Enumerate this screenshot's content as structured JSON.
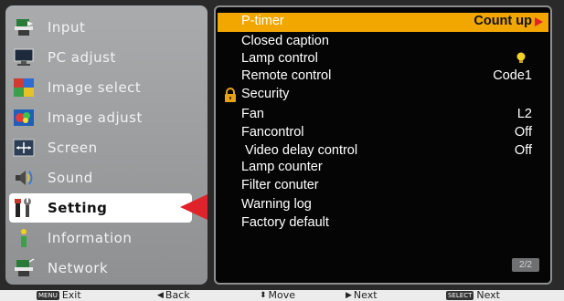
{
  "left_menu": {
    "items": [
      {
        "label": "Input",
        "icon": "input-icon"
      },
      {
        "label": "PC adjust",
        "icon": "pc-adjust-icon"
      },
      {
        "label": "Image select",
        "icon": "image-select-icon"
      },
      {
        "label": "Image adjust",
        "icon": "image-adjust-icon"
      },
      {
        "label": "Screen",
        "icon": "screen-icon"
      },
      {
        "label": "Sound",
        "icon": "sound-icon"
      },
      {
        "label": "Setting",
        "icon": "setting-icon"
      },
      {
        "label": "Information",
        "icon": "information-icon"
      },
      {
        "label": "Network",
        "icon": "network-icon"
      }
    ],
    "active_index": 6
  },
  "settings": {
    "rows": [
      {
        "name": "P-timer",
        "value": "Count up"
      },
      {
        "name": "Closed caption",
        "value": ""
      },
      {
        "name": "Lamp control",
        "value": ""
      },
      {
        "name": "Remote control",
        "value": "Code1"
      },
      {
        "name": "Security",
        "value": ""
      },
      {
        "name": "Fan",
        "value": "L2"
      },
      {
        "name": "Fancontrol",
        "value": "Off"
      },
      {
        "name": " Video delay control",
        "value": "Off"
      },
      {
        "name": "Lamp counter",
        "value": ""
      },
      {
        "name": "Filter conuter",
        "value": ""
      },
      {
        "name": "Warning log",
        "value": ""
      },
      {
        "name": "Factory default",
        "value": ""
      }
    ],
    "page": "2/2"
  },
  "bottom_bar": {
    "exit_key": "MENU",
    "exit_label": "Exit",
    "back_label": "Back",
    "move_label": "Move",
    "next_label": "Next",
    "select_key": "SELECT",
    "select_label": "Next"
  },
  "colors": {
    "highlight": "#f2a600",
    "accent_red": "#e0232b",
    "panel_bg": "#050505",
    "menu_bg": "#9c9e9f"
  }
}
